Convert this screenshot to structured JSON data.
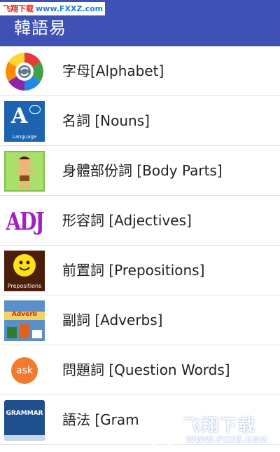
{
  "watermark_top": {
    "prefix": "飞翔下载",
    "site": "www.FXXZ.com"
  },
  "appbar": {
    "title": "韓語易"
  },
  "list": [
    {
      "icon": "alphabet-wheel-icon",
      "label": "字母[Alphabet]"
    },
    {
      "icon": "nouns-language-icon",
      "label": "名詞 [Nouns]"
    },
    {
      "icon": "body-boy-icon",
      "label": "身體部份詞 [Body Parts]"
    },
    {
      "icon": "adj-text-icon",
      "icon_text": "ADJ",
      "label": "形容詞 [Adjectives]"
    },
    {
      "icon": "smiley-prepositions-icon",
      "icon_text": "Prepositions",
      "label": "前置詞 [Prepositions]"
    },
    {
      "icon": "adverb-blocks-icon",
      "icon_text": "Adverb",
      "label": "副詞 [Adverbs]"
    },
    {
      "icon": "ask-bubble-icon",
      "icon_text": "ask",
      "label": "問題詞 [Question Words]"
    },
    {
      "icon": "grammar-book-icon",
      "icon_text": "GRAMMAR",
      "label": "語法 [Gram"
    }
  ],
  "nouns_icon_caption": "Language",
  "watermark_bottom": {
    "brand": "飞翔下载",
    "url": "WWW.FXXZ.COM"
  },
  "colors": {
    "appbar": "#3f51b5",
    "divider": "#e3e3e3",
    "label_text": "#222222"
  }
}
